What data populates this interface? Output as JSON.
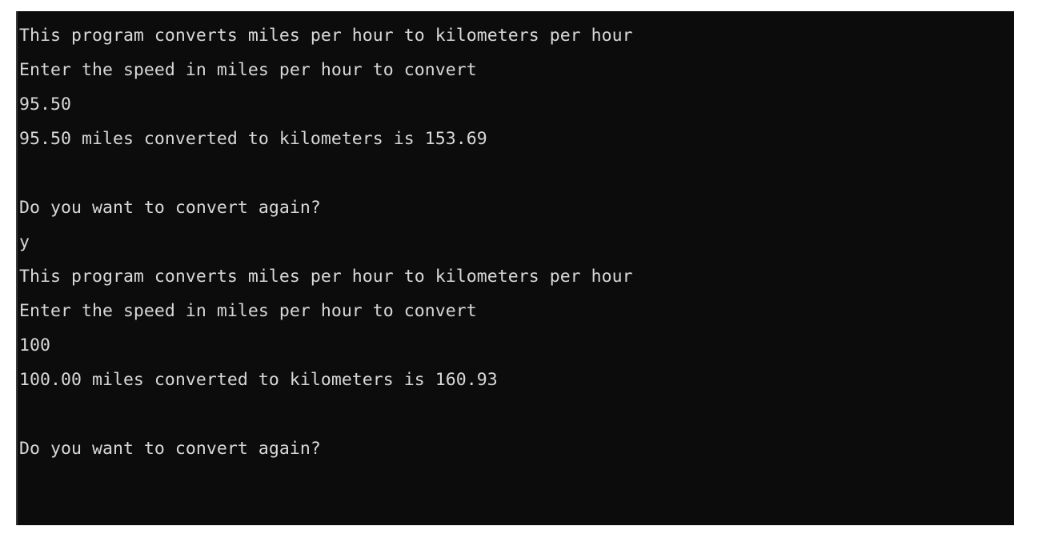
{
  "window": {
    "kind": "console-output",
    "background_color": "#ffffff",
    "terminal_background_color": "#0c0c0c",
    "terminal_text_color": "#d8d8d8"
  },
  "terminal": {
    "caret_column_color": "#3b3b3b",
    "lines": [
      {
        "id": "line-1",
        "text": "This program converts miles per hour to kilometers per hour",
        "role": "program-output"
      },
      {
        "id": "line-2",
        "text": "Enter the speed in miles per hour to convert",
        "role": "program-prompt"
      },
      {
        "id": "line-3",
        "text": "95.50",
        "role": "user-input"
      },
      {
        "id": "line-4",
        "text": "95.50 miles converted to kilometers is 153.69",
        "role": "program-output"
      },
      {
        "id": "line-5",
        "text": "",
        "role": "blank"
      },
      {
        "id": "line-6",
        "text": "Do you want to convert again?",
        "role": "program-prompt"
      },
      {
        "id": "line-7",
        "text": "y",
        "role": "user-input"
      },
      {
        "id": "line-8",
        "text": "This program converts miles per hour to kilometers per hour",
        "role": "program-output"
      },
      {
        "id": "line-9",
        "text": "Enter the speed in miles per hour to convert",
        "role": "program-prompt"
      },
      {
        "id": "line-10",
        "text": "100",
        "role": "user-input"
      },
      {
        "id": "line-11",
        "text": "100.00 miles converted to kilometers is 160.93",
        "role": "program-output"
      },
      {
        "id": "line-12",
        "text": "",
        "role": "blank"
      },
      {
        "id": "line-13",
        "text": "Do you want to convert again?",
        "role": "program-prompt"
      },
      {
        "id": "line-14",
        "text": "",
        "role": "cursor-line"
      }
    ]
  }
}
